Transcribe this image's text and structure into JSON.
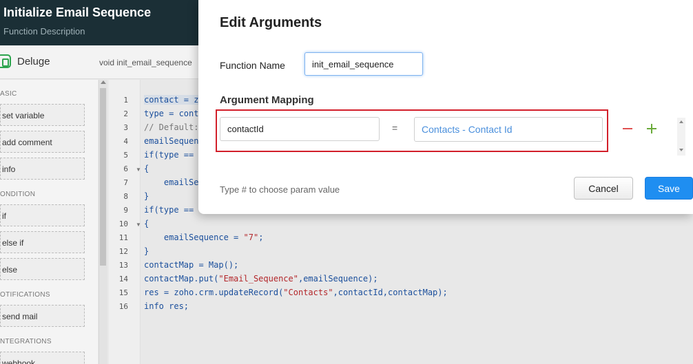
{
  "app": {
    "title": "Initialize Email Sequence",
    "subtitle": "Function Description",
    "editor_label": "Deluge",
    "function_signature": "void init_email_sequence"
  },
  "palette": {
    "sections": [
      "ASIC",
      "ONDITION",
      "OTIFICATIONS",
      "NTEGRATIONS"
    ],
    "blocks": [
      "set variable",
      "add comment",
      "info",
      "if",
      "else if",
      "else",
      "send mail",
      "webhook"
    ]
  },
  "code": {
    "line_numbers": [
      "1",
      "2",
      "3",
      "4",
      "5",
      "6",
      "7",
      "8",
      "9",
      "10",
      "11",
      "12",
      "13",
      "14",
      "15",
      "16"
    ],
    "lines": {
      "l1": "contact = z",
      "l2": "type = cont",
      "l3": "// Default:",
      "l4": "emailSequen",
      "l5": "if(type ==",
      "l6": "{",
      "l7a": "    emailSe",
      "l8": "}",
      "l9": "if(type ==",
      "l10": "{",
      "l11a": "    emailSequence = ",
      "l11b": "\"7\"",
      "l11c": ";",
      "l12": "}",
      "l13": "contactMap = Map();",
      "l14a": "contactMap.put(",
      "l14b": "\"Email_Sequence\"",
      "l14c": ",emailSequence);",
      "l15a": "res = zoho.crm.updateRecord(",
      "l15b": "\"Contacts\"",
      "l15c": ",contactId,contactMap);",
      "l16": "info res;"
    }
  },
  "modal": {
    "title": "Edit Arguments",
    "function_name_label": "Function Name",
    "function_name_value": "init_email_sequence",
    "argument_mapping_label": "Argument Mapping",
    "argument_name": "contactId",
    "equals": "=",
    "argument_value": "Contacts - Contact Id",
    "hint": "Type # to choose param value",
    "cancel_label": "Cancel",
    "save_label": "Save"
  },
  "colors": {
    "header_bg": "#1b2f36",
    "accent_blue": "#1f8ef1",
    "highlight_red": "#d21f2a",
    "minus_red": "#e05050",
    "plus_green": "#6aaa3a"
  }
}
